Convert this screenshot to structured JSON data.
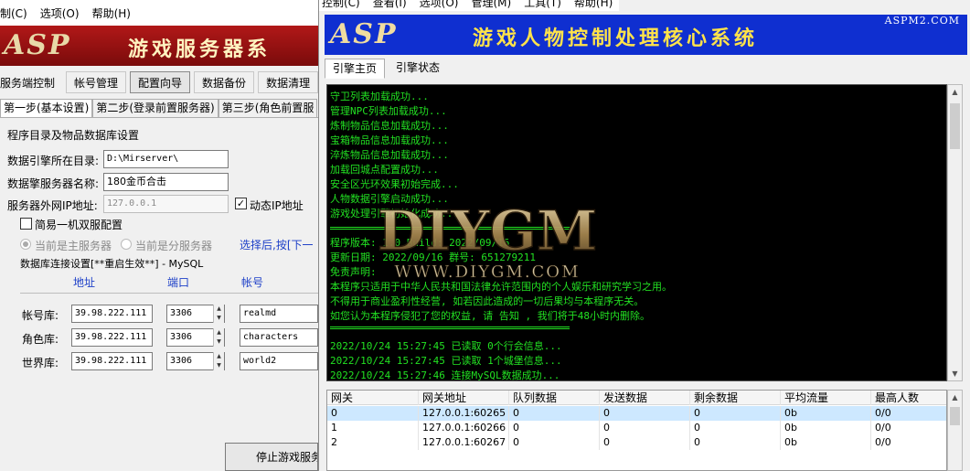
{
  "left_window": {
    "menu": [
      "制(C)",
      "选项(O)",
      "帮助(H)"
    ],
    "banner": {
      "logo": "ASP",
      "title": "游戏服务器系"
    },
    "toolbar": [
      "服务端控制",
      "帐号管理",
      "配置向导",
      "数据备份",
      "数据清理"
    ],
    "toolbar_active": "配置向导",
    "steps": [
      "第一步(基本设置)",
      "第二步(登录前置服务器)",
      "第三步(角色前置服"
    ],
    "panel": {
      "section_title": "程序目录及物品数据库设置",
      "data_dir_label": "数据引擎所在目录:",
      "data_dir_value": "D:\\Mirserver\\",
      "server_name_label": "数据擎服务器名称:",
      "server_name_value": "180金币合击",
      "ext_ip_label": "服务器外网IP地址:",
      "ext_ip_value": "127.0.0.1",
      "dynamic_ip_label": "动态IP地址",
      "dynamic_ip_checked": "✓",
      "dual_label": "简易一机双服配置",
      "primary_label": "当前是主服务器",
      "secondary_label": "当前是分服务器",
      "hint": "选择后,按[下一",
      "db_title": "数据库连接设置[**重启生效**] - MySQL",
      "col_addr": "地址",
      "col_port": "端口",
      "col_account": "帐号",
      "rows": [
        {
          "label": "帐号库:",
          "addr": "39.98.222.111",
          "port": "3306",
          "account": "realmd"
        },
        {
          "label": "角色库:",
          "addr": "39.98.222.111",
          "port": "3306",
          "account": "characters"
        },
        {
          "label": "世界库:",
          "addr": "39.98.222.111",
          "port": "3306",
          "account": "world2"
        }
      ]
    },
    "stop_button": "停止游戏服务"
  },
  "right_window": {
    "menu": [
      "控制(C)",
      "查看(I)",
      "选项(O)",
      "管理(M)",
      "工具(T)",
      "帮助(H)"
    ],
    "banner": {
      "logo": "ASP",
      "title": "游戏人物控制处理核心系统",
      "site": "ASPM2.COM"
    },
    "tabs": [
      "引擎主页",
      "引擎状态"
    ],
    "console": [
      "守卫列表加载成功...",
      "管理NPC列表加载成功...",
      "炼制物品信息加载成功...",
      "宝箱物品信息加载成功...",
      "淬炼物品信息加载成功...",
      "加载回城点配置成功...",
      "安全区光环效果初始完成...",
      "人物数据引擎启动成功...",
      "游戏处理引擎初始化成功...",
      "程序版本: 1.0 Build: 2022/09/16",
      "更新日期: 2022/09/16  群号: 651279211",
      "免责声明:",
      "本程序只适用于中华人民共和国法律允许范围内的个人娱乐和研究学习之用。",
      "不得用于商业盈利性经营, 如若因此造成的一切后果均与本程序无关。",
      "如您认为本程序侵犯了您的权益, 请 告知 , 我们将于48小时内删除。",
      "2022/10/24 15:27:45 已读取 0个行会信息...",
      "2022/10/24 15:27:45 已读取 1个城堡信息...",
      "2022/10/24 15:27:46 连接MySQL数据成功..."
    ],
    "grid": {
      "columns": [
        "网关",
        "网关地址",
        "队列数据",
        "发送数据",
        "剩余数据",
        "平均流量",
        "最高人数"
      ],
      "rows": [
        [
          "0",
          "127.0.0.1:60265",
          "0",
          "0",
          "0",
          "0b",
          "0/0"
        ],
        [
          "1",
          "127.0.0.1:60266",
          "0",
          "0",
          "0",
          "0b",
          "0/0"
        ],
        [
          "2",
          "127.0.0.1:60267",
          "0",
          "0",
          "0",
          "0b",
          "0/0"
        ]
      ]
    }
  },
  "watermark": {
    "logo": "DIYGM",
    "url": "WWW.DIYGM.COM"
  },
  "colors": {
    "console_text": "#22e022",
    "banner_blue": "#0f2fd0",
    "banner_red": "#b11818",
    "label_blue": "#1e40c8"
  }
}
